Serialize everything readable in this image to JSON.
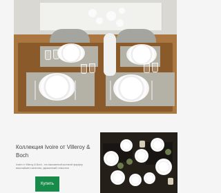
{
  "product": {
    "title": "Коллекция Ivoire от Villeroy & Boch",
    "description": "Ivoire от Villeroy & Boch - это изысканный костяной фарфор высочайшего качества, украшенный тонкостью",
    "buy_label": "Купить"
  },
  "icons": {
    "hero": "table-setting-photo",
    "promo": "dinnerware-photo"
  },
  "colors": {
    "accent": "#188a4a",
    "text": "#444444",
    "background": "#f4f5f4"
  }
}
